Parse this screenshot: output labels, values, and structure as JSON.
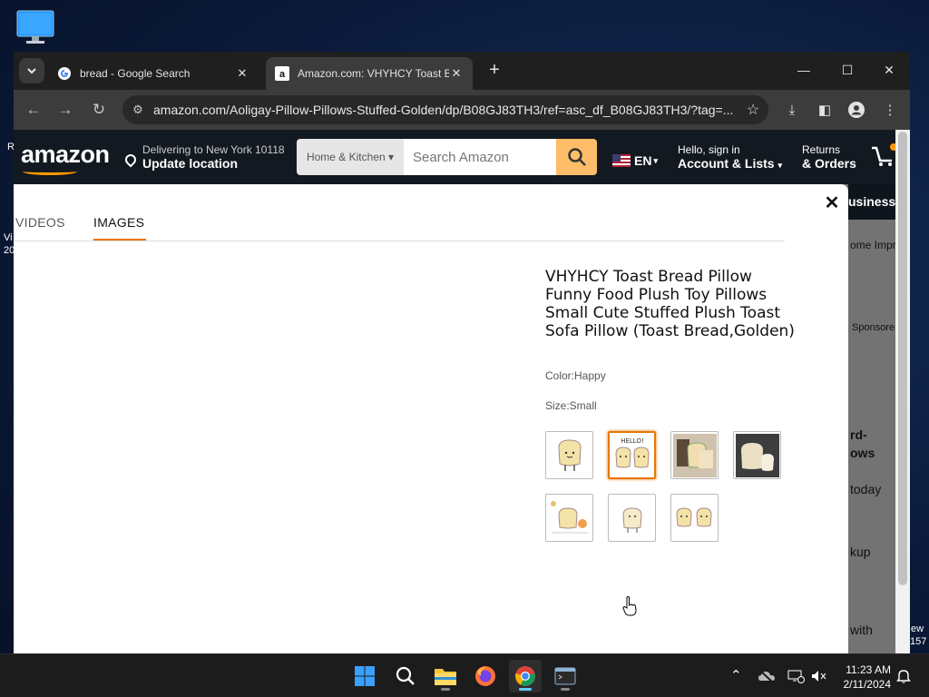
{
  "desktop": {
    "icon": "this-pc-icon",
    "edge_texts": [
      "R",
      "Vi",
      "20",
      "ew",
      "157"
    ]
  },
  "browser": {
    "tabs": [
      {
        "title": "bread - Google Search",
        "favicon": "google-icon",
        "active": false
      },
      {
        "title": "Amazon.com: VHYHCY Toast Br",
        "favicon": "amazon-icon",
        "active": true
      }
    ],
    "url": "amazon.com/Aoligay-Pillow-Pillows-Stuffed-Golden/dp/B08GJ83TH3/ref=asc_df_B08GJ83TH3/?tag=...",
    "icons": [
      "back-icon",
      "forward-icon",
      "reload-icon",
      "tune-icon",
      "star-icon",
      "download-icon",
      "sidebar-icon",
      "profile-icon",
      "menu-icon"
    ]
  },
  "amazon": {
    "logo": "amazon",
    "deliver": {
      "line1": "Delivering to New York 10118",
      "line2": "Update location"
    },
    "search": {
      "category": "Home & Kitchen",
      "placeholder": "Search Amazon"
    },
    "lang": "EN",
    "account": {
      "line1": "Hello, sign in",
      "line2": "Account & Lists"
    },
    "orders": {
      "line1": "Returns",
      "line2": "& Orders"
    },
    "background_fragments": {
      "business": "usiness",
      "home_impr": "ome Impro",
      "sponsored": "Sponsore",
      "rd": "rd-",
      "ows": "ows",
      "today": "today",
      "kup": "kup",
      "with": "with"
    }
  },
  "modal": {
    "tabs": [
      {
        "label": "VIDEOS",
        "active": false
      },
      {
        "label": "IMAGES",
        "active": true
      }
    ],
    "product_title": "VHYHCY Toast Bread Pillow Funny Food Plush Toy Pillows Small Cute Stuffed Plush Toast Sofa Pillow (Toast Bread,Golden)",
    "color": "Color:Happy",
    "size": "Size:Small",
    "thumbnails": [
      {
        "name": "thumb-1",
        "selected": false
      },
      {
        "name": "thumb-2",
        "selected": true,
        "caption": "HELLO!"
      },
      {
        "name": "thumb-3",
        "selected": false
      },
      {
        "name": "thumb-4",
        "selected": false
      },
      {
        "name": "thumb-5",
        "selected": false
      },
      {
        "name": "thumb-6",
        "selected": false
      },
      {
        "name": "thumb-7",
        "selected": false
      }
    ]
  },
  "taskbar": {
    "apps": [
      "start-icon",
      "search-icon",
      "file-explorer-icon",
      "firefox-icon",
      "chrome-icon",
      "terminal-icon"
    ],
    "active_app": "chrome-icon",
    "time": "11:23 AM",
    "date": "2/11/2024"
  }
}
